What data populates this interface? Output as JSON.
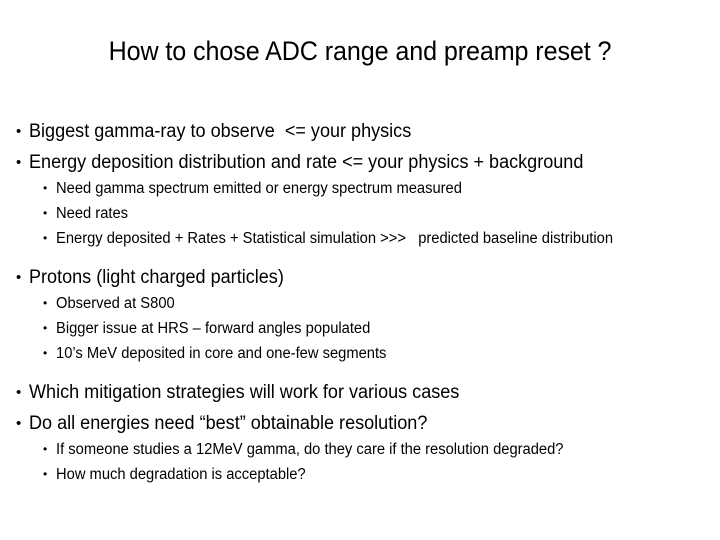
{
  "slide": {
    "title": "How to chose ADC range and preamp reset ?",
    "background_color": "#ffffff",
    "text_color": "#000000",
    "bullet_glyph": "•",
    "bullets": [
      {
        "level": 1,
        "text": "Biggest gamma-ray to observe  <= your physics"
      },
      {
        "level": 1,
        "text": "Energy deposition distribution and rate <= your physics + background"
      },
      {
        "level": 2,
        "text": "Need gamma spectrum emitted or energy spectrum measured"
      },
      {
        "level": 2,
        "text": "Need rates"
      },
      {
        "level": 2,
        "text": "Energy deposited + Rates + Statistical simulation >>>   predicted baseline distribution"
      },
      {
        "level": 1,
        "text": "Protons (light charged particles)"
      },
      {
        "level": 2,
        "text": "Observed at S800"
      },
      {
        "level": 2,
        "text": "Bigger issue at HRS – forward angles populated"
      },
      {
        "level": 2,
        "text": "10’s MeV deposited in core and one-few segments"
      },
      {
        "level": 1,
        "text": "Which mitigation strategies will work for various cases"
      },
      {
        "level": 1,
        "text": "Do all energies need “best” obtainable resolution?"
      },
      {
        "level": 2,
        "text": "If someone studies a 12MeV gamma, do they care if the resolution degraded?"
      },
      {
        "level": 2,
        "text": "How much degradation is acceptable?"
      }
    ]
  }
}
